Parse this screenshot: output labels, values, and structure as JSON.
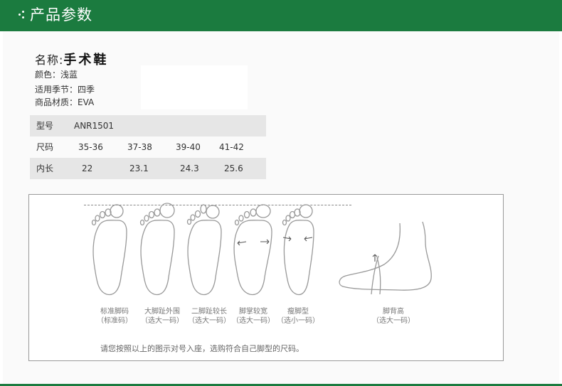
{
  "header": {
    "title": "产品参数"
  },
  "product": {
    "name_label": "名称:",
    "name_value": "手术鞋",
    "color": "颜色：浅蓝",
    "season": "适用季节：四季",
    "material": "商品材质：EVA"
  },
  "size_table": {
    "rows": [
      {
        "label": "型号",
        "values": [
          "ANR1501"
        ]
      },
      {
        "label": "尺码",
        "values": [
          "35-36",
          "37-38",
          "39-40",
          "41-42"
        ]
      },
      {
        "label": "内长",
        "values": [
          "22",
          "23.1",
          "24.3",
          "25.6"
        ]
      }
    ]
  },
  "guide": {
    "items": [
      {
        "title": "标准脚码",
        "hint": "（标准码）"
      },
      {
        "title": "大脚趾外围",
        "hint": "（选大一码）"
      },
      {
        "title": "二脚趾较长",
        "hint": "（选大一码）"
      },
      {
        "title": "脚掌较宽",
        "hint": "（选大一码）"
      },
      {
        "title": "瘦脚型",
        "hint": "（选小一码）"
      },
      {
        "title": "脚背高",
        "hint": "（选大一码）"
      }
    ],
    "note": "请您按照以上的图示对号入座，选购符合自己脚型的尺码。"
  }
}
